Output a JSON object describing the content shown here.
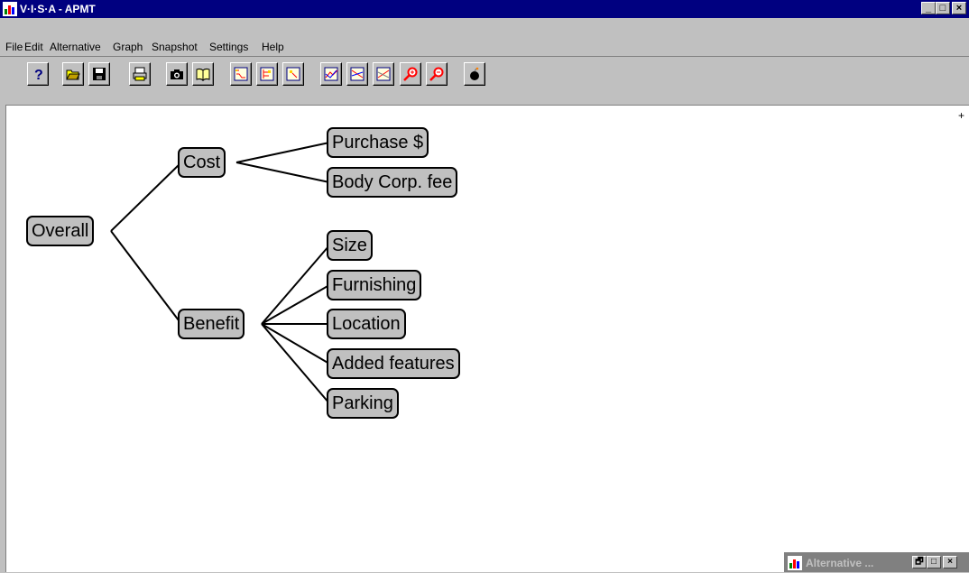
{
  "window": {
    "title": "V·I·S·A - APMT",
    "minimize_glyph": "_",
    "maximize_glyph": "□",
    "close_glyph": "×"
  },
  "menu": [
    {
      "label": "File",
      "icon": null
    },
    {
      "label": "Edit"
    },
    {
      "label": "Alternative"
    },
    {
      "label": "Graph"
    },
    {
      "label": "Snapshot"
    },
    {
      "label": "Settings"
    },
    {
      "label": "Help"
    }
  ],
  "toolbar": [
    {
      "name": "help-icon",
      "glyph": "?"
    },
    {
      "name": "open-folder-icon"
    },
    {
      "name": "save-icon"
    },
    {
      "name": "print-icon"
    },
    {
      "name": "camera-icon"
    },
    {
      "name": "book-icon"
    },
    {
      "name": "graph-1-icon"
    },
    {
      "name": "graph-2-icon"
    },
    {
      "name": "graph-3-icon"
    },
    {
      "name": "chart-1-icon"
    },
    {
      "name": "chart-2-icon"
    },
    {
      "name": "chart-3-icon"
    },
    {
      "name": "zoom-in-icon"
    },
    {
      "name": "zoom-out-icon"
    },
    {
      "name": "bomb-icon"
    }
  ],
  "tree": {
    "root": "Overall",
    "children": [
      {
        "label": "Cost",
        "children": [
          "Purchase $",
          "Body Corp. fee"
        ]
      },
      {
        "label": "Benefit",
        "children": [
          "Size",
          "Furnishing",
          "Location",
          "Added features",
          "Parking"
        ]
      }
    ]
  },
  "canvas_marker": "+",
  "minimized_window": {
    "title": "Alternative ...",
    "restore_glyph": "🗗",
    "maximize_glyph": "□",
    "close_glyph": "×"
  },
  "colors": {
    "titlebar": "#000080",
    "chrome": "#c0c0c0",
    "node_fill": "#c0c0c0",
    "canvas": "#ffffff"
  }
}
